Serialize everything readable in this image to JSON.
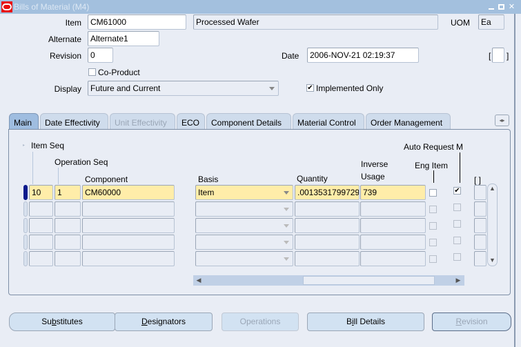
{
  "window": {
    "title": "Bills of Material (M4)",
    "controls": [
      "minimize",
      "maximize",
      "close"
    ]
  },
  "header": {
    "item_label": "Item",
    "item_value": "CM61000",
    "item_description": "Processed Wafer",
    "uom_label": "UOM",
    "uom_value": "Ea",
    "alternate_label": "Alternate",
    "alternate_value": "Alternate1",
    "revision_label": "Revision",
    "revision_value": "0",
    "date_label": "Date",
    "date_value": "2006-NOV-21 02:19:37",
    "co_product_label": "Co-Product",
    "co_product_checked": false,
    "display_label": "Display",
    "display_value": "Future and Current",
    "implemented_only_label": "Implemented Only",
    "implemented_only_checked": true,
    "flex_bracket_open": "[",
    "flex_bracket_close": "]"
  },
  "tabs": [
    {
      "label": "Main",
      "active": true,
      "disabled": false
    },
    {
      "label": "Date Effectivity",
      "active": false,
      "disabled": false
    },
    {
      "label": "Unit Effectivity",
      "active": false,
      "disabled": true
    },
    {
      "label": "ECO",
      "active": false,
      "disabled": false
    },
    {
      "label": "Component Details",
      "active": false,
      "disabled": false
    },
    {
      "label": "Material Control",
      "active": false,
      "disabled": false
    },
    {
      "label": "Order Management",
      "active": false,
      "disabled": false
    }
  ],
  "grid": {
    "headers": {
      "item_seq": "Item Seq",
      "operation_seq": "Operation Seq",
      "component": "Component",
      "basis": "Basis",
      "quantity": "Quantity",
      "inverse_usage_1": "Inverse",
      "inverse_usage_2": "Usage",
      "eng_item": "Eng Item",
      "auto_request": "Auto Request M",
      "flex": "[ ]"
    },
    "rows": [
      {
        "item_seq": "10",
        "operation_seq": "1",
        "component": "CM60000",
        "basis": "Item",
        "quantity": ".0013531799729",
        "inverse_usage": "739",
        "eng_item": false,
        "auto_request": true,
        "current": true
      },
      {
        "item_seq": "",
        "operation_seq": "",
        "component": "",
        "basis": "",
        "quantity": "",
        "inverse_usage": "",
        "eng_item": false,
        "auto_request": false,
        "current": false
      },
      {
        "item_seq": "",
        "operation_seq": "",
        "component": "",
        "basis": "",
        "quantity": "",
        "inverse_usage": "",
        "eng_item": false,
        "auto_request": false,
        "current": false
      },
      {
        "item_seq": "",
        "operation_seq": "",
        "component": "",
        "basis": "",
        "quantity": "",
        "inverse_usage": "",
        "eng_item": false,
        "auto_request": false,
        "current": false
      },
      {
        "item_seq": "",
        "operation_seq": "",
        "component": "",
        "basis": "",
        "quantity": "",
        "inverse_usage": "",
        "eng_item": false,
        "auto_request": false,
        "current": false
      }
    ]
  },
  "buttons": {
    "substitutes": {
      "pre": "Su",
      "u": "b",
      "post": "stitutes"
    },
    "designators": {
      "pre": "",
      "u": "D",
      "post": "esignators"
    },
    "operations": {
      "pre": "",
      "u": "",
      "post": "Operations"
    },
    "bill_details": {
      "pre": "B",
      "u": "i",
      "post": "ll Details"
    },
    "revision": {
      "pre": "",
      "u": "R",
      "post": "evision"
    }
  },
  "colors": {
    "titlebar": "#a3c0de",
    "highlight_field": "#ffeda9",
    "background": "#e9edf5",
    "current_row_indicator": "#0a1a8c"
  }
}
